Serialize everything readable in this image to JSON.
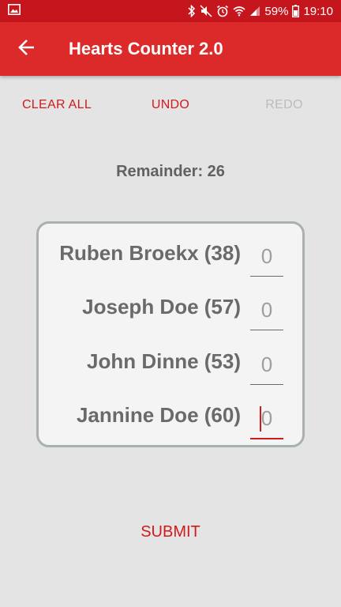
{
  "status_bar": {
    "battery": "59%",
    "time": "19:10"
  },
  "app_bar": {
    "title": "Hearts Counter 2.0"
  },
  "actions": {
    "clear_all": "CLEAR ALL",
    "undo": "UNDO",
    "redo": "REDO"
  },
  "remainder": "Remainder: 26",
  "players": [
    {
      "name": "Ruben Broekx (38)",
      "score": "0"
    },
    {
      "name": "Joseph Doe (57)",
      "score": "0"
    },
    {
      "name": "John Dinne (53)",
      "score": "0"
    },
    {
      "name": "Jannine Doe (60)",
      "score": "0"
    }
  ],
  "submit_label": "SUBMIT",
  "colors": {
    "primary": "#dc2a2a",
    "status_bar": "#c5161d",
    "accent_text": "#d11b1b",
    "disabled_text": "#bcbcbc"
  }
}
